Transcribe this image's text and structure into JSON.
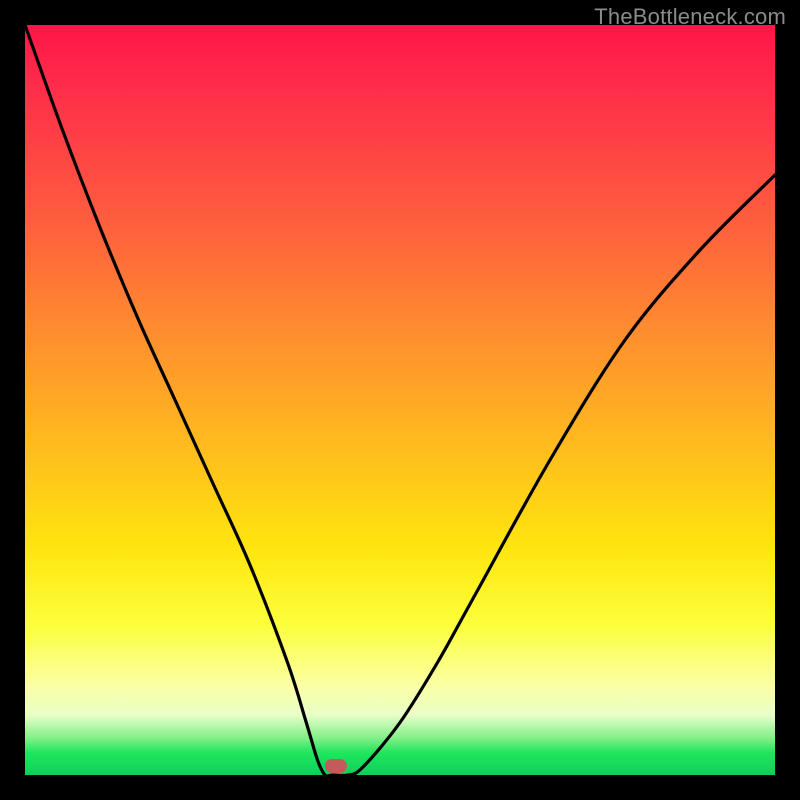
{
  "watermark": "TheBottleneck.com",
  "chart_data": {
    "type": "line",
    "title": "",
    "xlabel": "",
    "ylabel": "",
    "xlim": [
      0,
      1
    ],
    "ylim": [
      0,
      1
    ],
    "series": [
      {
        "name": "curve",
        "x": [
          0.0,
          0.05,
          0.1,
          0.15,
          0.2,
          0.25,
          0.3,
          0.35,
          0.375,
          0.39,
          0.4,
          0.41,
          0.43,
          0.45,
          0.5,
          0.55,
          0.6,
          0.7,
          0.8,
          0.9,
          1.0
        ],
        "y": [
          1.0,
          0.86,
          0.73,
          0.61,
          0.5,
          0.39,
          0.28,
          0.15,
          0.07,
          0.02,
          0.0,
          0.0,
          0.0,
          0.01,
          0.07,
          0.15,
          0.24,
          0.42,
          0.58,
          0.7,
          0.8
        ]
      }
    ],
    "marker": {
      "x": 0.415,
      "y": 0.012,
      "color": "#c45a5a"
    },
    "background_gradient": {
      "top": "#ff1548",
      "mid": "#ffe60f",
      "bottom": "#0bd158"
    }
  }
}
